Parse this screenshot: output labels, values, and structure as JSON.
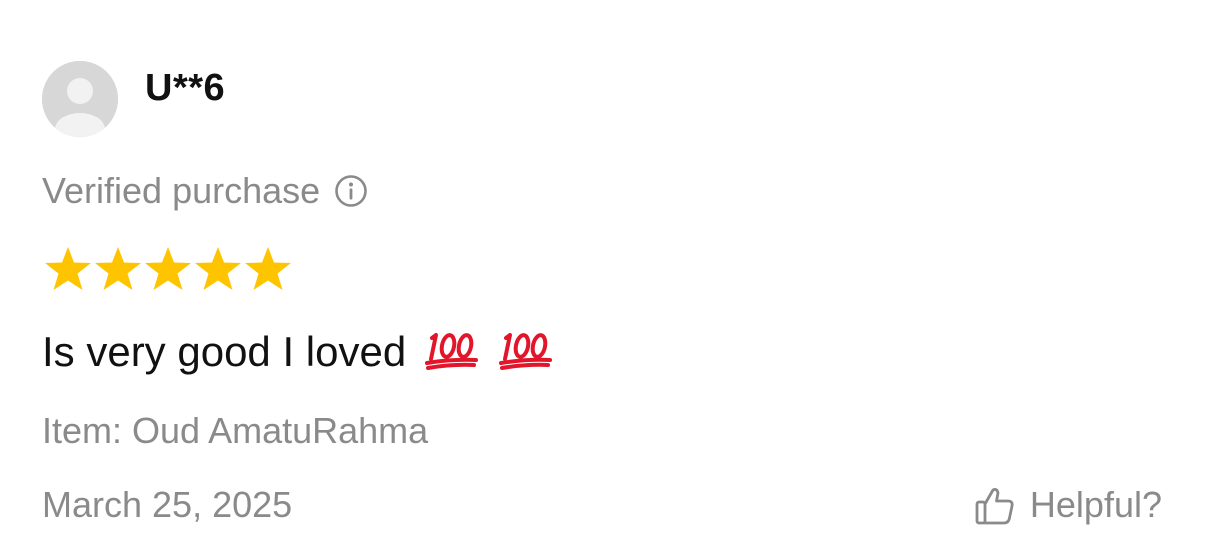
{
  "review": {
    "username": "U**6",
    "verified_label": "Verified purchase",
    "rating": 5,
    "rating_max": 5,
    "comment_text": "Is very good I loved",
    "comment_emojis": [
      "hundred-points-emoji",
      "hundred-points-emoji"
    ],
    "item_label": "Item: Oud AmatuRahma",
    "date": "March 25, 2025",
    "helpful_label": "Helpful?"
  },
  "icons": {
    "avatar": "default-avatar-icon",
    "info": "info-circle-icon",
    "star": "star-icon",
    "helpful": "thumbs-up-icon"
  },
  "colors": {
    "star": "#FFC400",
    "muted_text": "#8A8A8A",
    "primary_text": "#111111",
    "avatar_bg": "#D7D7D7",
    "emoji_red": "#E2152B"
  }
}
